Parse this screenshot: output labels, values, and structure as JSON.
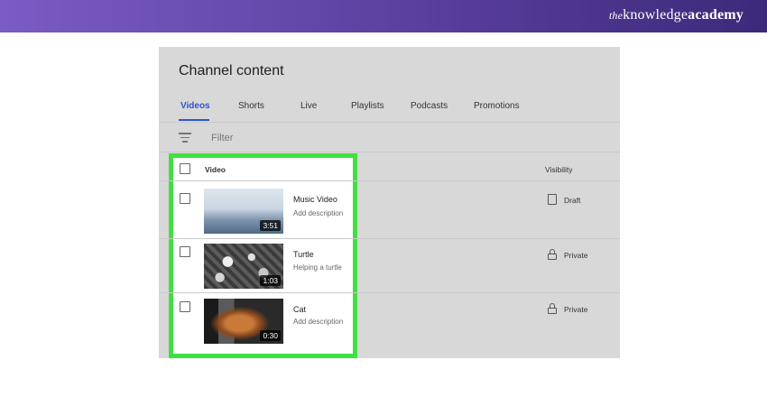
{
  "brand": {
    "prefix": "the",
    "knowledge": "knowledge",
    "academy": "academy"
  },
  "page": {
    "title": "Channel content"
  },
  "tabs": [
    {
      "label": "Videos",
      "active": true
    },
    {
      "label": "Shorts"
    },
    {
      "label": "Live"
    },
    {
      "label": "Playlists"
    },
    {
      "label": "Podcasts"
    },
    {
      "label": "Promotions"
    }
  ],
  "filter": {
    "label": "Filter",
    "icon": "filter-icon"
  },
  "table": {
    "columns": {
      "video": "Video",
      "visibility": "Visibility"
    },
    "rows": [
      {
        "title": "Music Video",
        "description": "Add description",
        "duration": "3:51",
        "visibility": "Draft",
        "visibility_icon": "draft-icon"
      },
      {
        "title": "Turtle",
        "description": "Helping a turtle",
        "duration": "1:03",
        "visibility": "Private",
        "visibility_icon": "lock-icon"
      },
      {
        "title": "Cat",
        "description": "Add description",
        "duration": "0:30",
        "visibility": "Private",
        "visibility_icon": "lock-icon"
      }
    ]
  },
  "colors": {
    "highlight": "#3fe03f",
    "accent": "#2f55c8",
    "header_start": "#7a5cc4",
    "header_end": "#3b2a7a"
  }
}
